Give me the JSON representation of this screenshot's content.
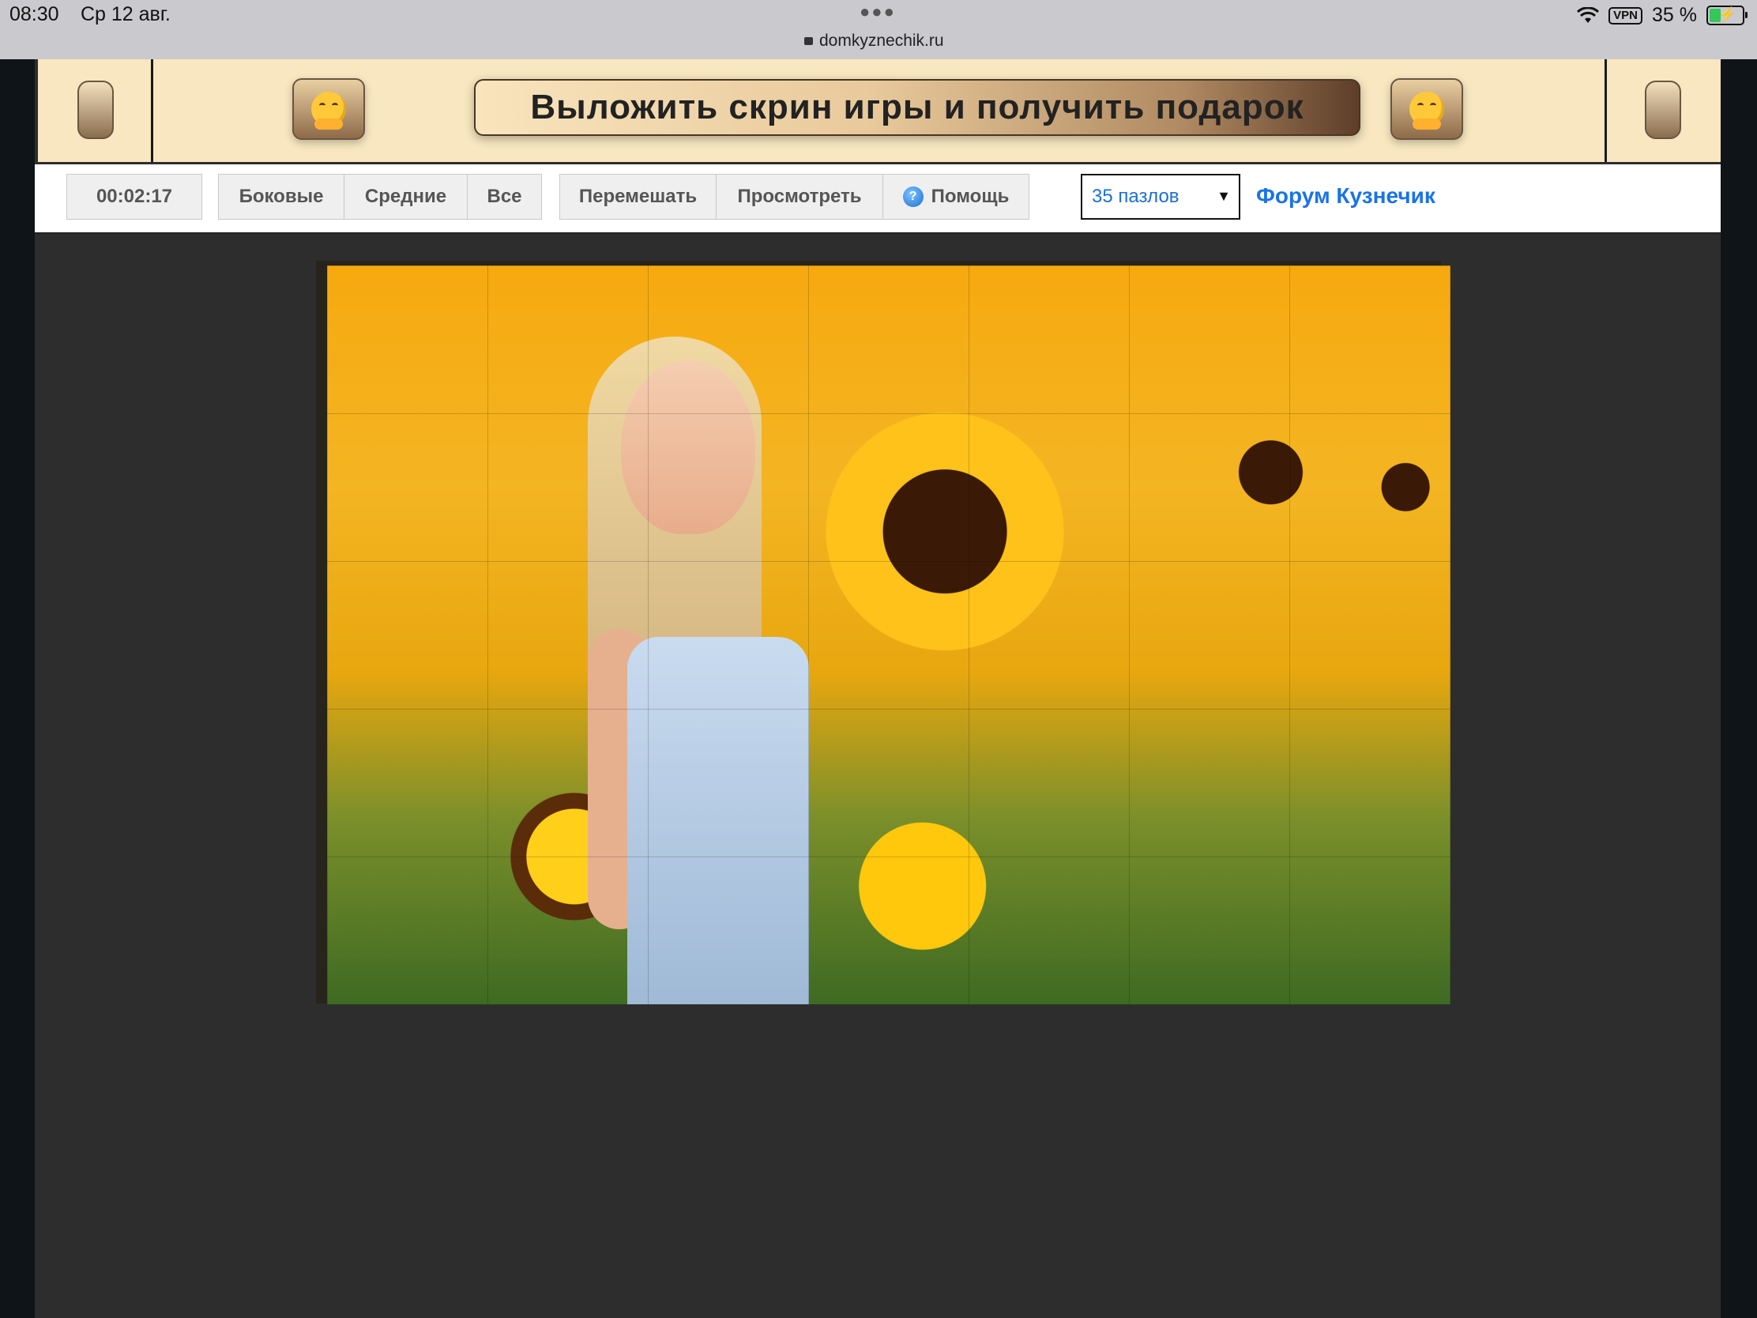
{
  "status_bar": {
    "time": "08:30",
    "date": "Ср 12 авг.",
    "url": "domkyznechik.ru",
    "vpn": "VPN",
    "battery": "35 %"
  },
  "banner": {
    "title": "Выложить скрин игры и получить подарок",
    "left_emoji_icon": "hugging-face-icon",
    "right_emoji_icon": "hugging-face-icon"
  },
  "toolbar": {
    "timer": "00:02:17",
    "sides_label": "Боковые",
    "middle_label": "Средние",
    "all_label": "Все",
    "shuffle_label": "Перемешать",
    "preview_label": "Просмотреть",
    "help_label": "Помощь",
    "pieces_select": "35 пазлов",
    "forum_link": "Форум Кузнечик"
  },
  "colors": {
    "link": "#1a73e8",
    "banner_bg": "#f8e7c0",
    "page_bg": "#2d2d2d"
  }
}
